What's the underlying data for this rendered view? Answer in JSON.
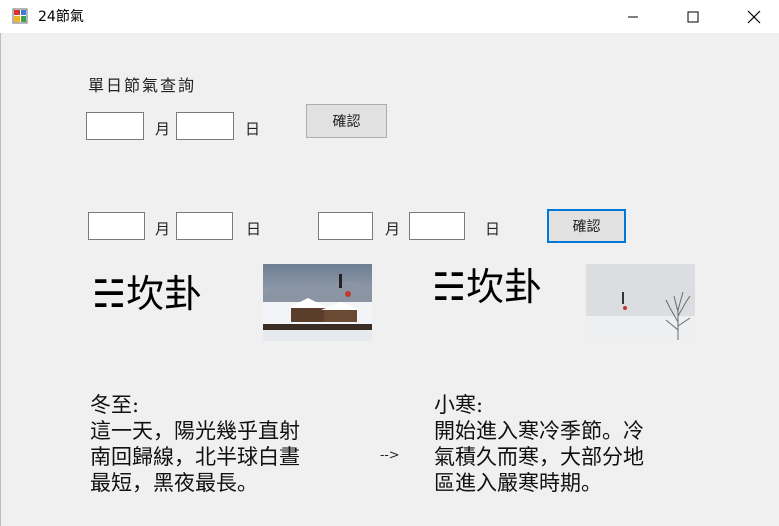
{
  "window": {
    "title": "24節氣"
  },
  "single_query": {
    "title": "單日節氣查詢",
    "month_value": "",
    "month_label": "月",
    "day_value": "",
    "day_label": "日",
    "confirm_label": "確認"
  },
  "range_query": {
    "start_month_value": "",
    "start_month_label": "月",
    "start_day_value": "",
    "start_day_label": "日",
    "end_month_value": "",
    "end_month_label": "月",
    "end_day_value": "",
    "end_day_label": "日",
    "confirm_label": "確認"
  },
  "left_result": {
    "gua": "☵坎卦",
    "term": "冬至:",
    "text": "這一天，陽光幾乎直射\n南回歸線，北半球白晝\n最短，黑夜最長。"
  },
  "arrow": "-->",
  "right_result": {
    "gua": "☵坎卦",
    "term": "小寒:",
    "text": "開始進入寒冷季節。冷\n氣積久而寒，大部分地\n區進入嚴寒時期。"
  }
}
